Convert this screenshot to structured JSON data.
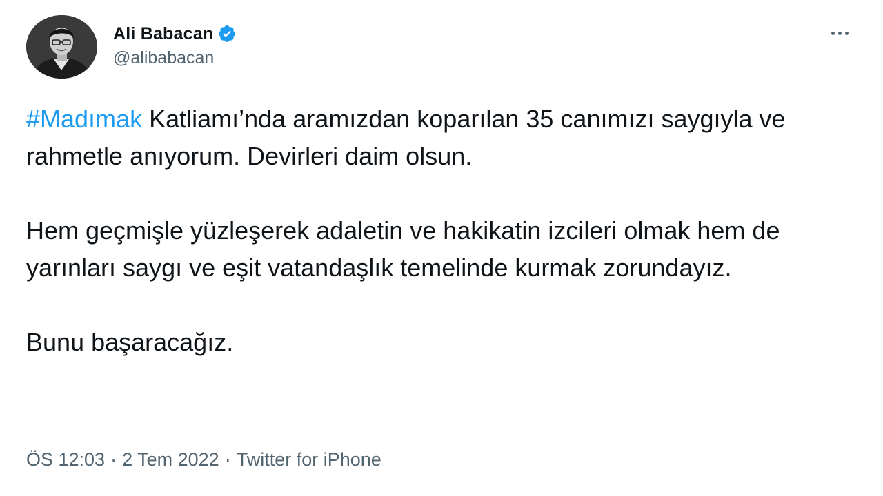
{
  "author": {
    "display_name": "Ali Babacan",
    "handle": "@alibabacan",
    "verified": true
  },
  "icons": {
    "verified": "verified-badge-icon",
    "more": "more-options-icon",
    "avatar": "profile-photo"
  },
  "colors": {
    "hashtag": "#1d9bf0",
    "verified_badge": "#1d9bf0",
    "secondary_text": "#536471",
    "primary_text": "#0f1419"
  },
  "tweet": {
    "hashtag": "#Madımak",
    "para1_rest": " Katliamı’nda aramızdan koparılan 35 canımızı saygıyla ve rahmetle anıyorum. Devirleri daim olsun.",
    "para2": "Hem geçmişle yüzleşerek adaletin ve hakikatin izcileri olmak hem de yarınları saygı ve eşit vatandaşlık temelinde kurmak zorundayız.",
    "para3": "Bunu başaracağız."
  },
  "meta": {
    "time": "ÖS 12:03",
    "separator": "·",
    "date": "2 Tem 2022",
    "source": "Twitter for iPhone"
  }
}
